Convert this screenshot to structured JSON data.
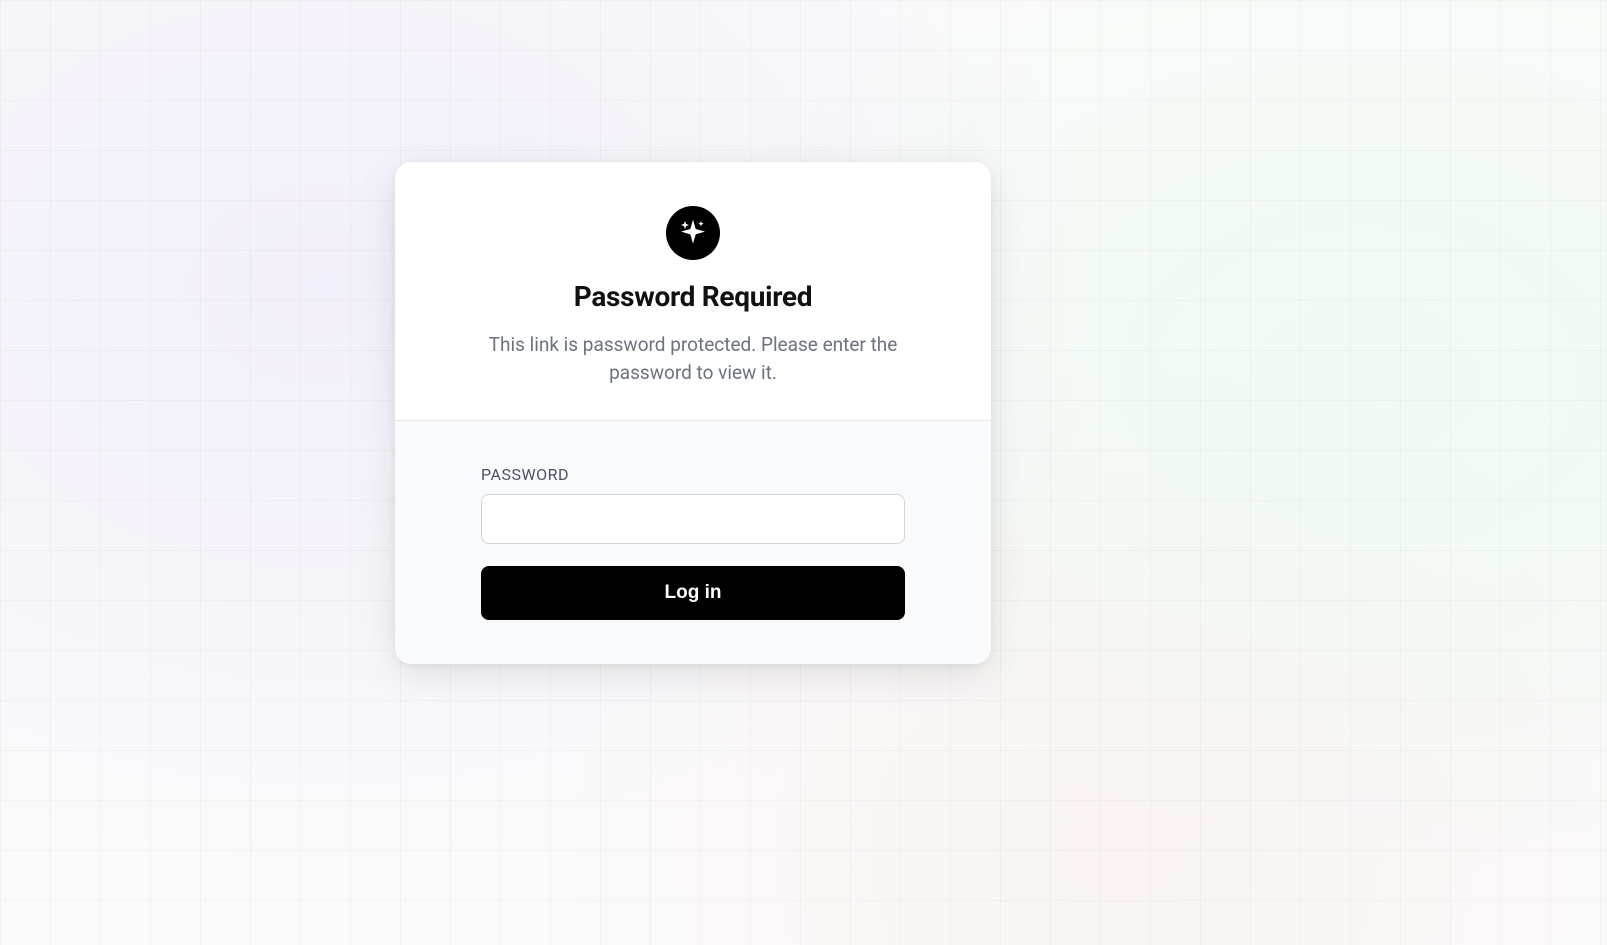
{
  "card": {
    "icon_name": "sparkle-icon",
    "title": "Password Required",
    "subtitle": "This link is password protected. Please enter the password to view it."
  },
  "form": {
    "password_label": "PASSWORD",
    "password_value": "",
    "login_button_label": "Log in"
  }
}
